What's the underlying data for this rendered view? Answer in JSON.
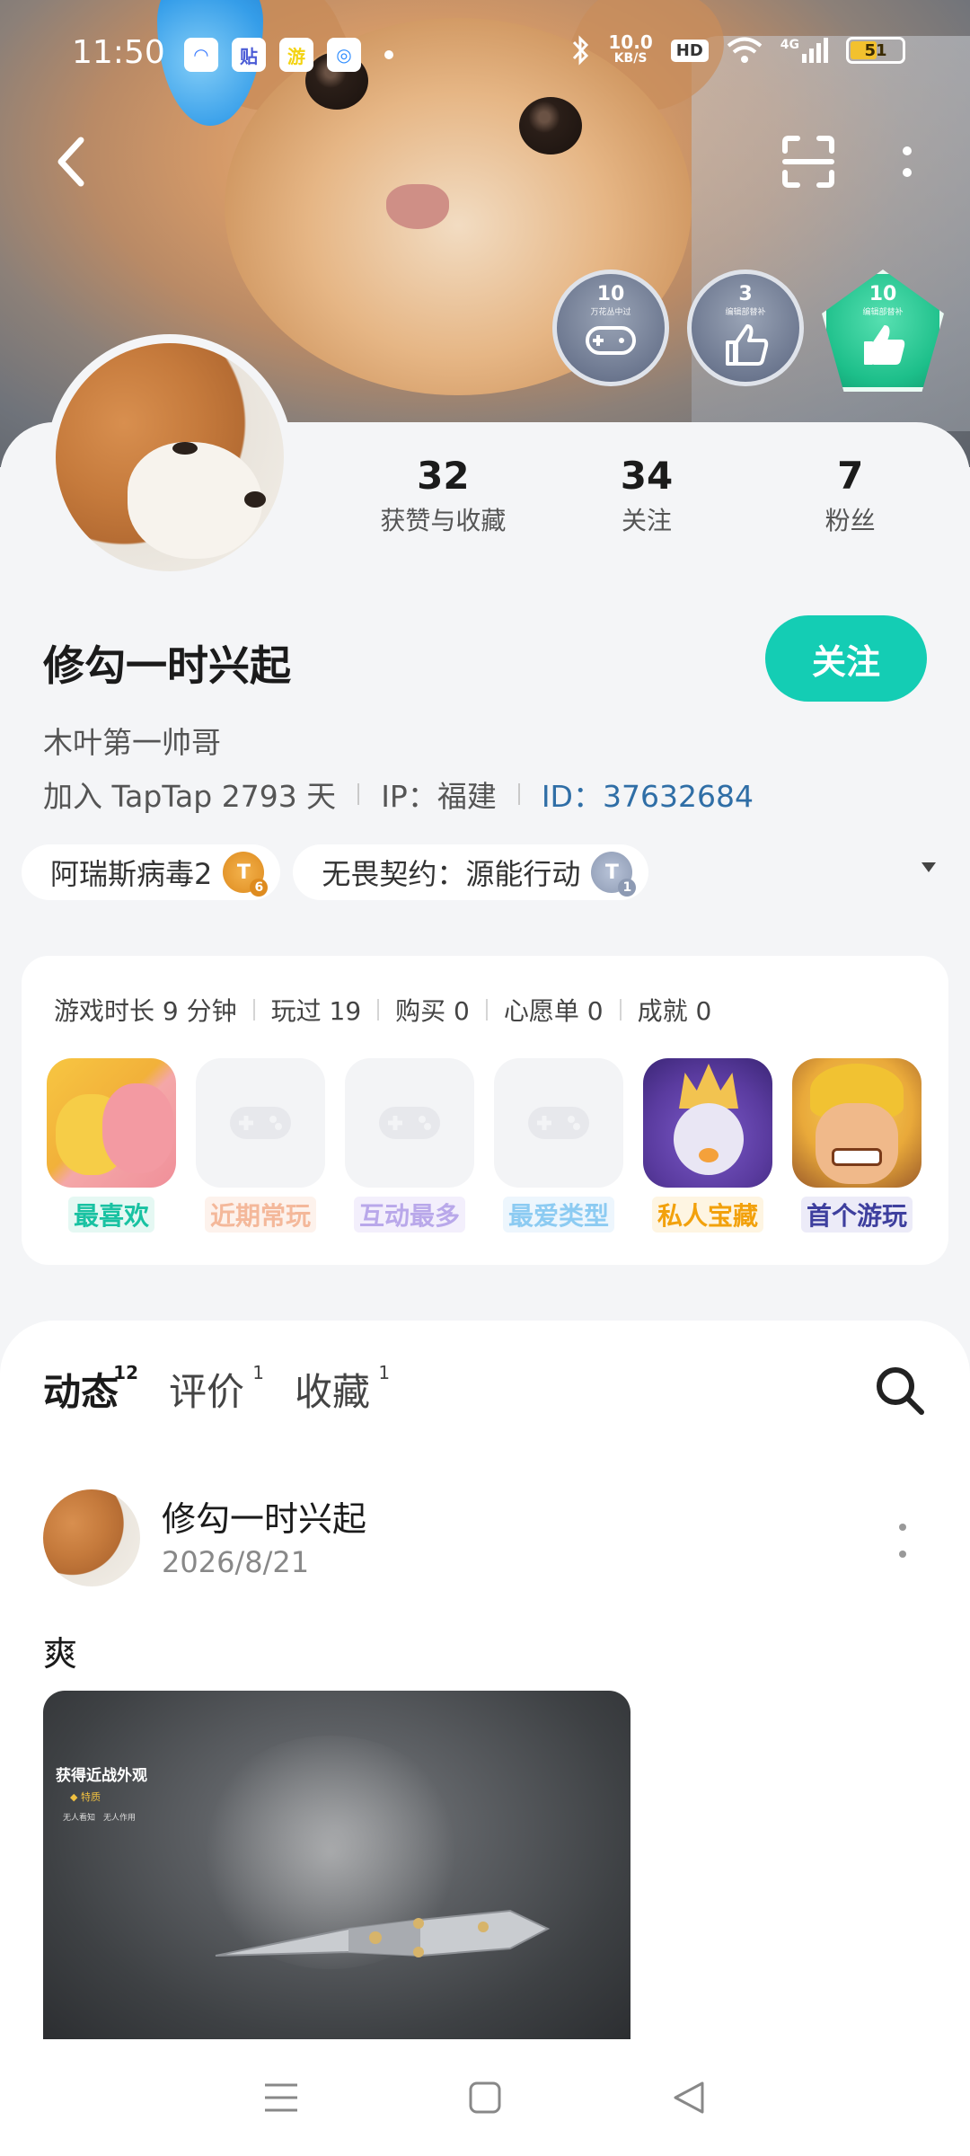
{
  "status_bar": {
    "time": "11:50",
    "notifications": [
      {
        "icon": "qq-browser-icon",
        "glyph": "◠",
        "color": "#3a7bff"
      },
      {
        "icon": "tieba-icon",
        "glyph": "贴",
        "color": "#4a5bd6"
      },
      {
        "icon": "game-app-icon",
        "glyph": "游",
        "color": "#f3d312"
      },
      {
        "icon": "qq-icon",
        "glyph": "◎",
        "color": "#2d8cff"
      }
    ],
    "net_speed_value": "10.0",
    "net_speed_unit": "KB/S",
    "hd_label": "HD",
    "network": "4G",
    "battery": "51",
    "battery_level": 0.51
  },
  "header": {
    "badges": [
      {
        "number": "10",
        "caption": "万花丛中过"
      },
      {
        "number": "3",
        "caption": "编辑部替补"
      },
      {
        "number": "10",
        "caption": "编辑部替补"
      }
    ]
  },
  "profile": {
    "stats": [
      {
        "value": "32",
        "label": "获赞与收藏"
      },
      {
        "value": "34",
        "label": "关注"
      },
      {
        "value": "7",
        "label": "粉丝"
      }
    ],
    "username": "修勾一时兴起",
    "follow_label": "关注",
    "bio": "木叶第一帅哥",
    "joined": "加入 TapTap 2793 天",
    "ip": "IP：福建",
    "id": "ID：37632684",
    "game_tags": [
      {
        "name": "阿瑞斯病毒2",
        "icon_letter": "T",
        "icon_level": "6",
        "icon_color": "gold"
      },
      {
        "name": "无畏契约：源能行动",
        "icon_letter": "T",
        "icon_level": "1",
        "icon_color": "silver"
      }
    ]
  },
  "game_card": {
    "stats": [
      "游戏时长 9 分钟",
      "玩过 19",
      "购买 0",
      "心愿单 0",
      "成就 0"
    ],
    "items": [
      {
        "label": "最喜欢",
        "color": "#19c2a2",
        "bg": "#e5f8f3",
        "icon": "fav"
      },
      {
        "label": "近期常玩",
        "color": "#f4b89a",
        "bg": "#fdf2ec",
        "icon": "placeholder"
      },
      {
        "label": "互动最多",
        "color": "#b9a8ea",
        "bg": "#f3effc",
        "icon": "placeholder"
      },
      {
        "label": "最爱类型",
        "color": "#8ccbf2",
        "bg": "#edf6fd",
        "icon": "placeholder"
      },
      {
        "label": "私人宝藏",
        "color": "#f2a10c",
        "bg": "#fef5e2",
        "icon": "priv"
      },
      {
        "label": "首个游玩",
        "color": "#3e3f9e",
        "bg": "#ecebf8",
        "icon": "coc"
      }
    ]
  },
  "feed": {
    "tabs": [
      {
        "label": "动态",
        "count": "12",
        "active": true
      },
      {
        "label": "评价",
        "count": "1",
        "active": false
      },
      {
        "label": "收藏",
        "count": "1",
        "active": false
      }
    ],
    "post": {
      "author": "修勾一时兴起",
      "date": "2026/8/21",
      "text": "爽",
      "image_overlay_title": "获得近战外观",
      "image_overlay_sub": "◆ 特质",
      "image_overlay_sub2": "无人看知　无人作用"
    }
  }
}
